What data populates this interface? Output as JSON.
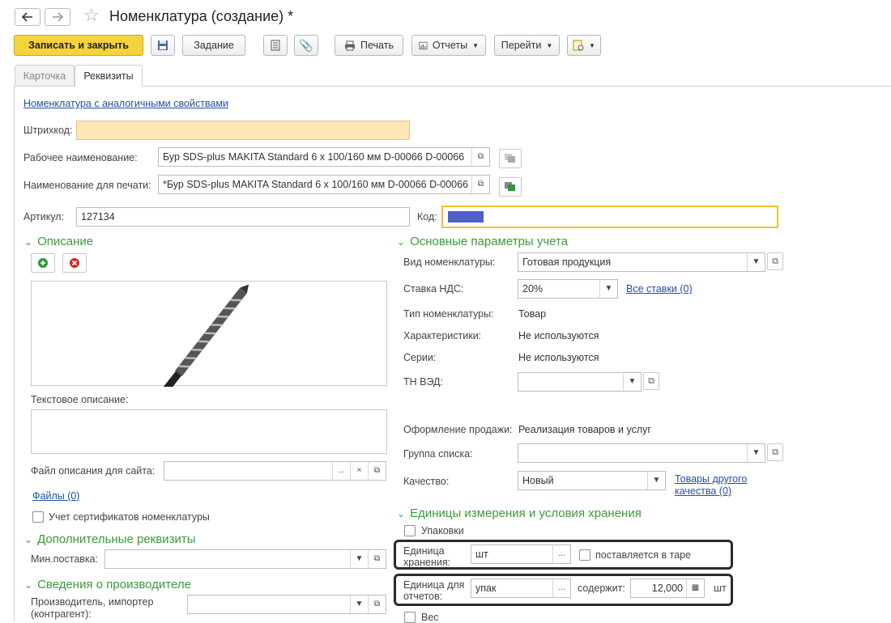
{
  "window": {
    "title": "Номенклатура (создание) *"
  },
  "toolbar": {
    "save_close": "Записать и закрыть",
    "task": "Задание",
    "print": "Печать",
    "reports": "Отчеты",
    "goto": "Перейти"
  },
  "tabs": [
    "Карточка",
    "Реквизиты"
  ],
  "top": {
    "analog_link": "Номенклатура с аналогичными свойствами",
    "barcode_label": "Штрихкод:",
    "barcode_value": "",
    "work_name_label": "Рабочее наименование:",
    "work_name_value": "Бур SDS-plus MAKITA Standard 6 x 100/160 мм D-00066 D-00066",
    "print_name_label": "Наименование для печати:",
    "print_name_value": "*Бур SDS-plus MAKITA Standard 6 x 100/160 мм D-00066 D-00066",
    "article_label": "Артикул:",
    "article_value": "127134",
    "code_label": "Код:"
  },
  "left": {
    "desc_title": "Описание",
    "text_desc_label": "Текстовое описание:",
    "file_label": "Файл описания для сайта:",
    "files_link": "Файлы (0)",
    "cert_label": "Учет сертификатов номенклатуры",
    "add_title": "Дополнительные реквизиты",
    "min_label": "Мин.поставка:",
    "maker_title": "Сведения о производителе",
    "maker_label": "Производитель, импортер (контрагент):"
  },
  "right": {
    "params_title": "Основные параметры учета",
    "kind_label": "Вид номенклатуры:",
    "kind_value": "Готовая продукция",
    "vat_label": "Ставка НДС:",
    "vat_value": "20%",
    "all_rates": "Все ставки (0)",
    "type_label": "Тип номенклатуры:",
    "type_value": "Товар",
    "char_label": "Характеристики:",
    "char_value": "Не используются",
    "series_label": "Серии:",
    "series_value": "Не используются",
    "tnved_label": "ТН ВЭД:",
    "sale_label": "Оформление продажи:",
    "sale_value": "Реализация товаров и услуг",
    "group_label": "Группа списка:",
    "quality_label": "Качество:",
    "quality_value": "Новый",
    "other_quality": "Товары другого качества (0)",
    "units_title": "Единицы измерения и условия хранения",
    "pack_label": "Упаковки",
    "store_unit_label": "Единица хранения:",
    "store_unit_value": "шт",
    "tare_label": "поставляется в таре",
    "report_unit_label": "Единица для отчетов:",
    "report_unit_value": "упак",
    "contains_label": "содержит:",
    "contains_value": "12,000",
    "contains_unit": "шт",
    "weight_label": "Вес"
  },
  "colors": {
    "accent_yellow": "#f5d33a",
    "section_green": "#3a9a3a",
    "link_blue": "#1f4fa8",
    "barcode_bg": "#fde5b4",
    "code_fill": "#4d5fcf"
  }
}
